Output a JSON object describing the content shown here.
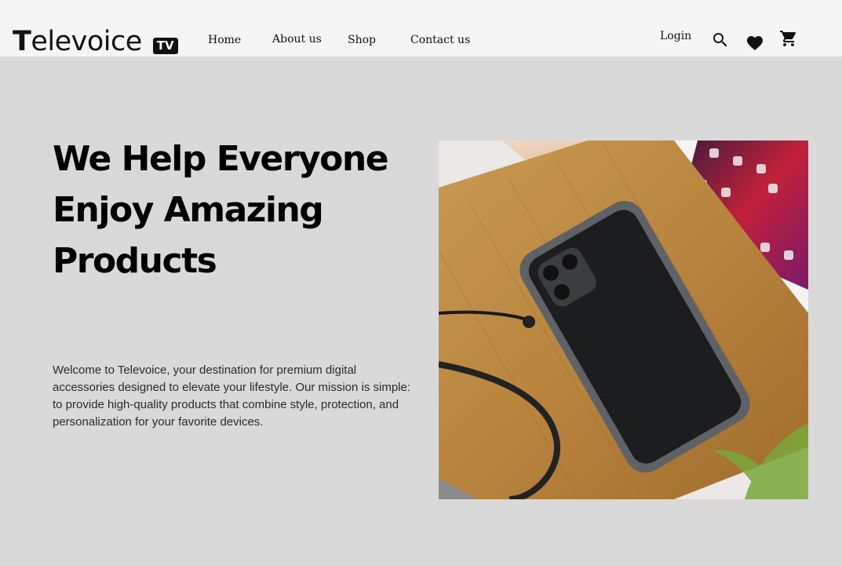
{
  "brand": {
    "first_letter": "T",
    "rest": "elevoice",
    "badge": "TV"
  },
  "nav": {
    "home": "Home",
    "about": "About us",
    "shop": "Shop",
    "contact": "Contact us"
  },
  "header_actions": {
    "login": "Login",
    "icons": [
      "search-icon",
      "heart-icon",
      "cart-icon"
    ]
  },
  "hero": {
    "headline": "We Help Everyone Enjoy Amazing Products",
    "intro": "Welcome to Televoice, your destination for premium digital accessories designed to elevate your lifestyle. Our mission is simple: to provide high-quality products that combine style, protection, and personalization for your favorite devices."
  },
  "colors": {
    "page_bg": "#d9d9d9",
    "header_bg": "#f5f5f5",
    "text": "#111111"
  }
}
